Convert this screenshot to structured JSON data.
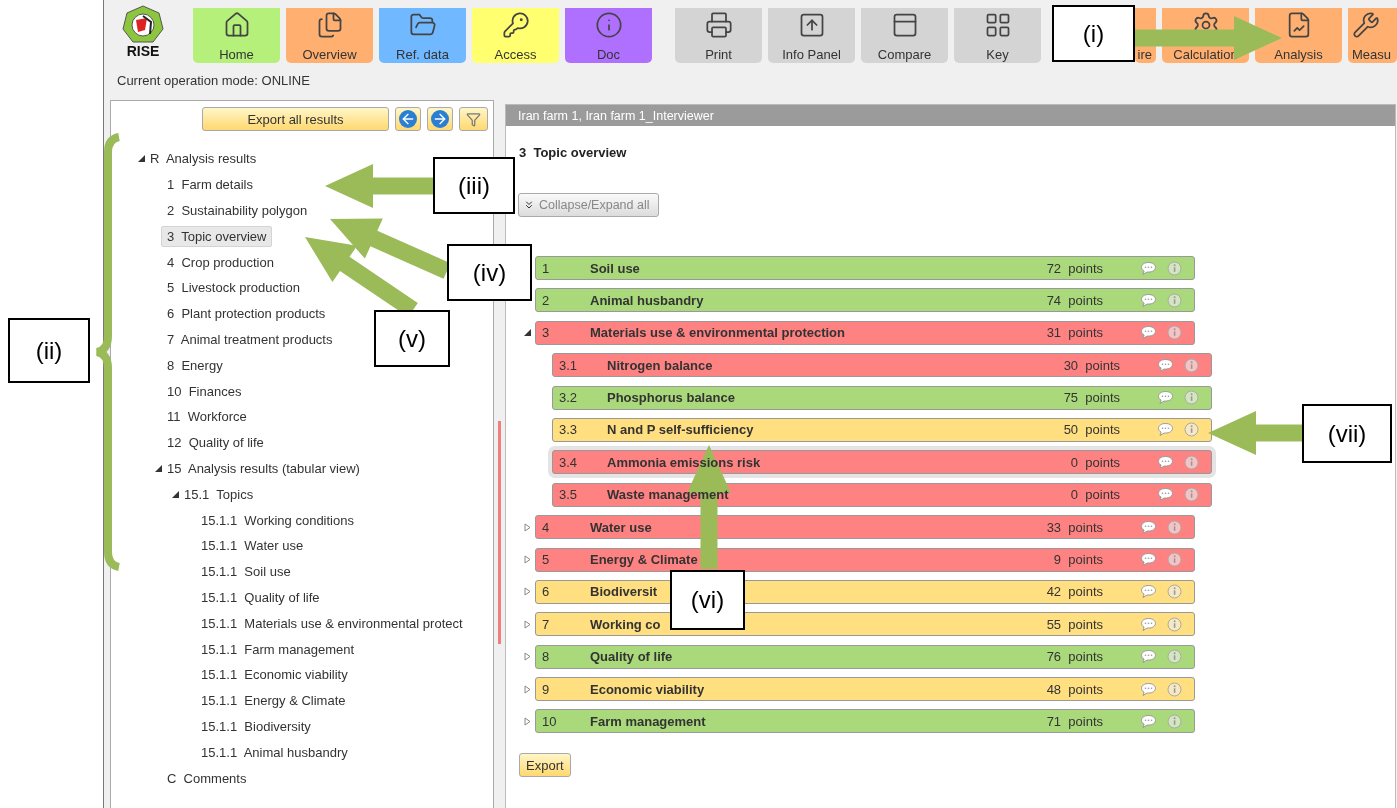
{
  "logo": {
    "text": "RISE"
  },
  "toolbar_groups": [
    [
      {
        "label": "Home",
        "color": "#b5f07a"
      },
      {
        "label": "Overview",
        "color": "#ffb070"
      },
      {
        "label": "Ref. data",
        "color": "#70b8ff"
      },
      {
        "label": "Access",
        "color": "#ffff70"
      },
      {
        "label": "Doc",
        "color": "#b070ff"
      }
    ],
    [
      {
        "label": "Print",
        "color": "#d4d4d4"
      },
      {
        "label": "Info Panel",
        "color": "#d4d4d4"
      },
      {
        "label": "Compare",
        "color": "#d4d4d4"
      },
      {
        "label": "Key",
        "color": "#d4d4d4"
      }
    ],
    [
      {
        "label": "ire",
        "color": "#ffb070"
      },
      {
        "label": "Calculation",
        "color": "#ffb070"
      },
      {
        "label": "Analysis",
        "color": "#ffb070"
      },
      {
        "label": "Measu",
        "color": "#ffb070"
      }
    ]
  ],
  "status": "Current operation mode: ONLINE",
  "sidebar": {
    "export_button": "Export all results",
    "tree": [
      {
        "label": "R  Analysis results",
        "expanded": true,
        "selected": false,
        "children": [
          {
            "label": "1  Farm details",
            "selected": false
          },
          {
            "label": "2  Sustainability polygon",
            "selected": false
          },
          {
            "label": "3  Topic overview",
            "selected": true
          },
          {
            "label": "4  Crop production",
            "selected": false
          },
          {
            "label": "5  Livestock production",
            "selected": false
          },
          {
            "label": "6  Plant protection products",
            "selected": false
          },
          {
            "label": "7  Animal treatment products",
            "selected": false
          },
          {
            "label": "8  Energy",
            "selected": false
          },
          {
            "label": "10  Finances",
            "selected": false
          },
          {
            "label": "11  Workforce",
            "selected": false
          },
          {
            "label": "12  Quality of life",
            "selected": false
          },
          {
            "label": "15  Analysis results (tabular view)",
            "expanded": true,
            "selected": false,
            "children": [
              {
                "label": "15.1  Topics",
                "expanded": true,
                "selected": false,
                "children": [
                  {
                    "label": "15.1.1  Working conditions",
                    "selected": false
                  },
                  {
                    "label": "15.1.1  Water use",
                    "selected": false
                  },
                  {
                    "label": "15.1.1  Soil use",
                    "selected": false
                  },
                  {
                    "label": "15.1.1  Quality of life",
                    "selected": false
                  },
                  {
                    "label": "15.1.1  Materials use & environmental protect",
                    "selected": false
                  },
                  {
                    "label": "15.1.1  Farm management",
                    "selected": false
                  },
                  {
                    "label": "15.1.1  Economic viability",
                    "selected": false
                  },
                  {
                    "label": "15.1.1  Energy & Climate",
                    "selected": false
                  },
                  {
                    "label": "15.1.1  Biodiversity",
                    "selected": false
                  },
                  {
                    "label": "15.1.1  Animal husbandry",
                    "selected": false
                  }
                ]
              }
            ]
          },
          {
            "label": "C  Comments",
            "selected": false
          }
        ]
      }
    ]
  },
  "content": {
    "header": "Iran farm 1, Iran farm 1_Interviewer",
    "title": "3  Topic overview",
    "collapse_button": "Collapse/Expand all",
    "topics": [
      {
        "number": "1",
        "title": "Soil use",
        "points": "72  points",
        "color": "#aad97b"
      },
      {
        "number": "2",
        "title": "Animal husbandry",
        "points": "74  points",
        "color": "#aad97b"
      },
      {
        "number": "3",
        "title": "Materials use & environmental protection",
        "points": "31  points",
        "color": "#ff8282",
        "expanded": true,
        "children": [
          {
            "number": "3.1",
            "title": "Nitrogen balance",
            "points": "30  points",
            "color": "#ff8282",
            "selected": false
          },
          {
            "number": "3.2",
            "title": "Phosphorus balance",
            "points": "75  points",
            "color": "#aad97b",
            "selected": false
          },
          {
            "number": "3.3",
            "title": "N and P self-sufficiency",
            "points": "50  points",
            "color": "#ffdf80",
            "selected": false
          },
          {
            "number": "3.4",
            "title": "Ammonia emissions risk",
            "points": "0  points",
            "color": "#ff8282",
            "selected": true
          },
          {
            "number": "3.5",
            "title": "Waste management",
            "points": "0  points",
            "color": "#ff8282",
            "selected": false
          }
        ]
      },
      {
        "number": "4",
        "title": "Water use",
        "points": "33  points",
        "color": "#ff8282",
        "expanded": false
      },
      {
        "number": "5",
        "title": "Energy & Climate",
        "points": "9  points",
        "color": "#ff8282",
        "expanded": false
      },
      {
        "number": "6",
        "title": "Biodiversit",
        "points": "42  points",
        "color": "#ffdf80",
        "expanded": false
      },
      {
        "number": "7",
        "title": "Working co",
        "points": "55  points",
        "color": "#ffdf80",
        "expanded": false
      },
      {
        "number": "8",
        "title": "Quality of life",
        "points": "76  points",
        "color": "#aad97b",
        "expanded": false
      },
      {
        "number": "9",
        "title": "Economic viability",
        "points": "48  points",
        "color": "#ffdf80",
        "expanded": false
      },
      {
        "number": "10",
        "title": "Farm management",
        "points": "71  points",
        "color": "#aad97b",
        "expanded": false
      }
    ],
    "export_button": "Export"
  },
  "callouts": [
    {
      "label": "(i)"
    },
    {
      "label": "(ii)"
    },
    {
      "label": "(iii)"
    },
    {
      "label": "(iv)"
    },
    {
      "label": "(v)"
    },
    {
      "label": "(vi)"
    },
    {
      "label": "(vii)"
    }
  ]
}
